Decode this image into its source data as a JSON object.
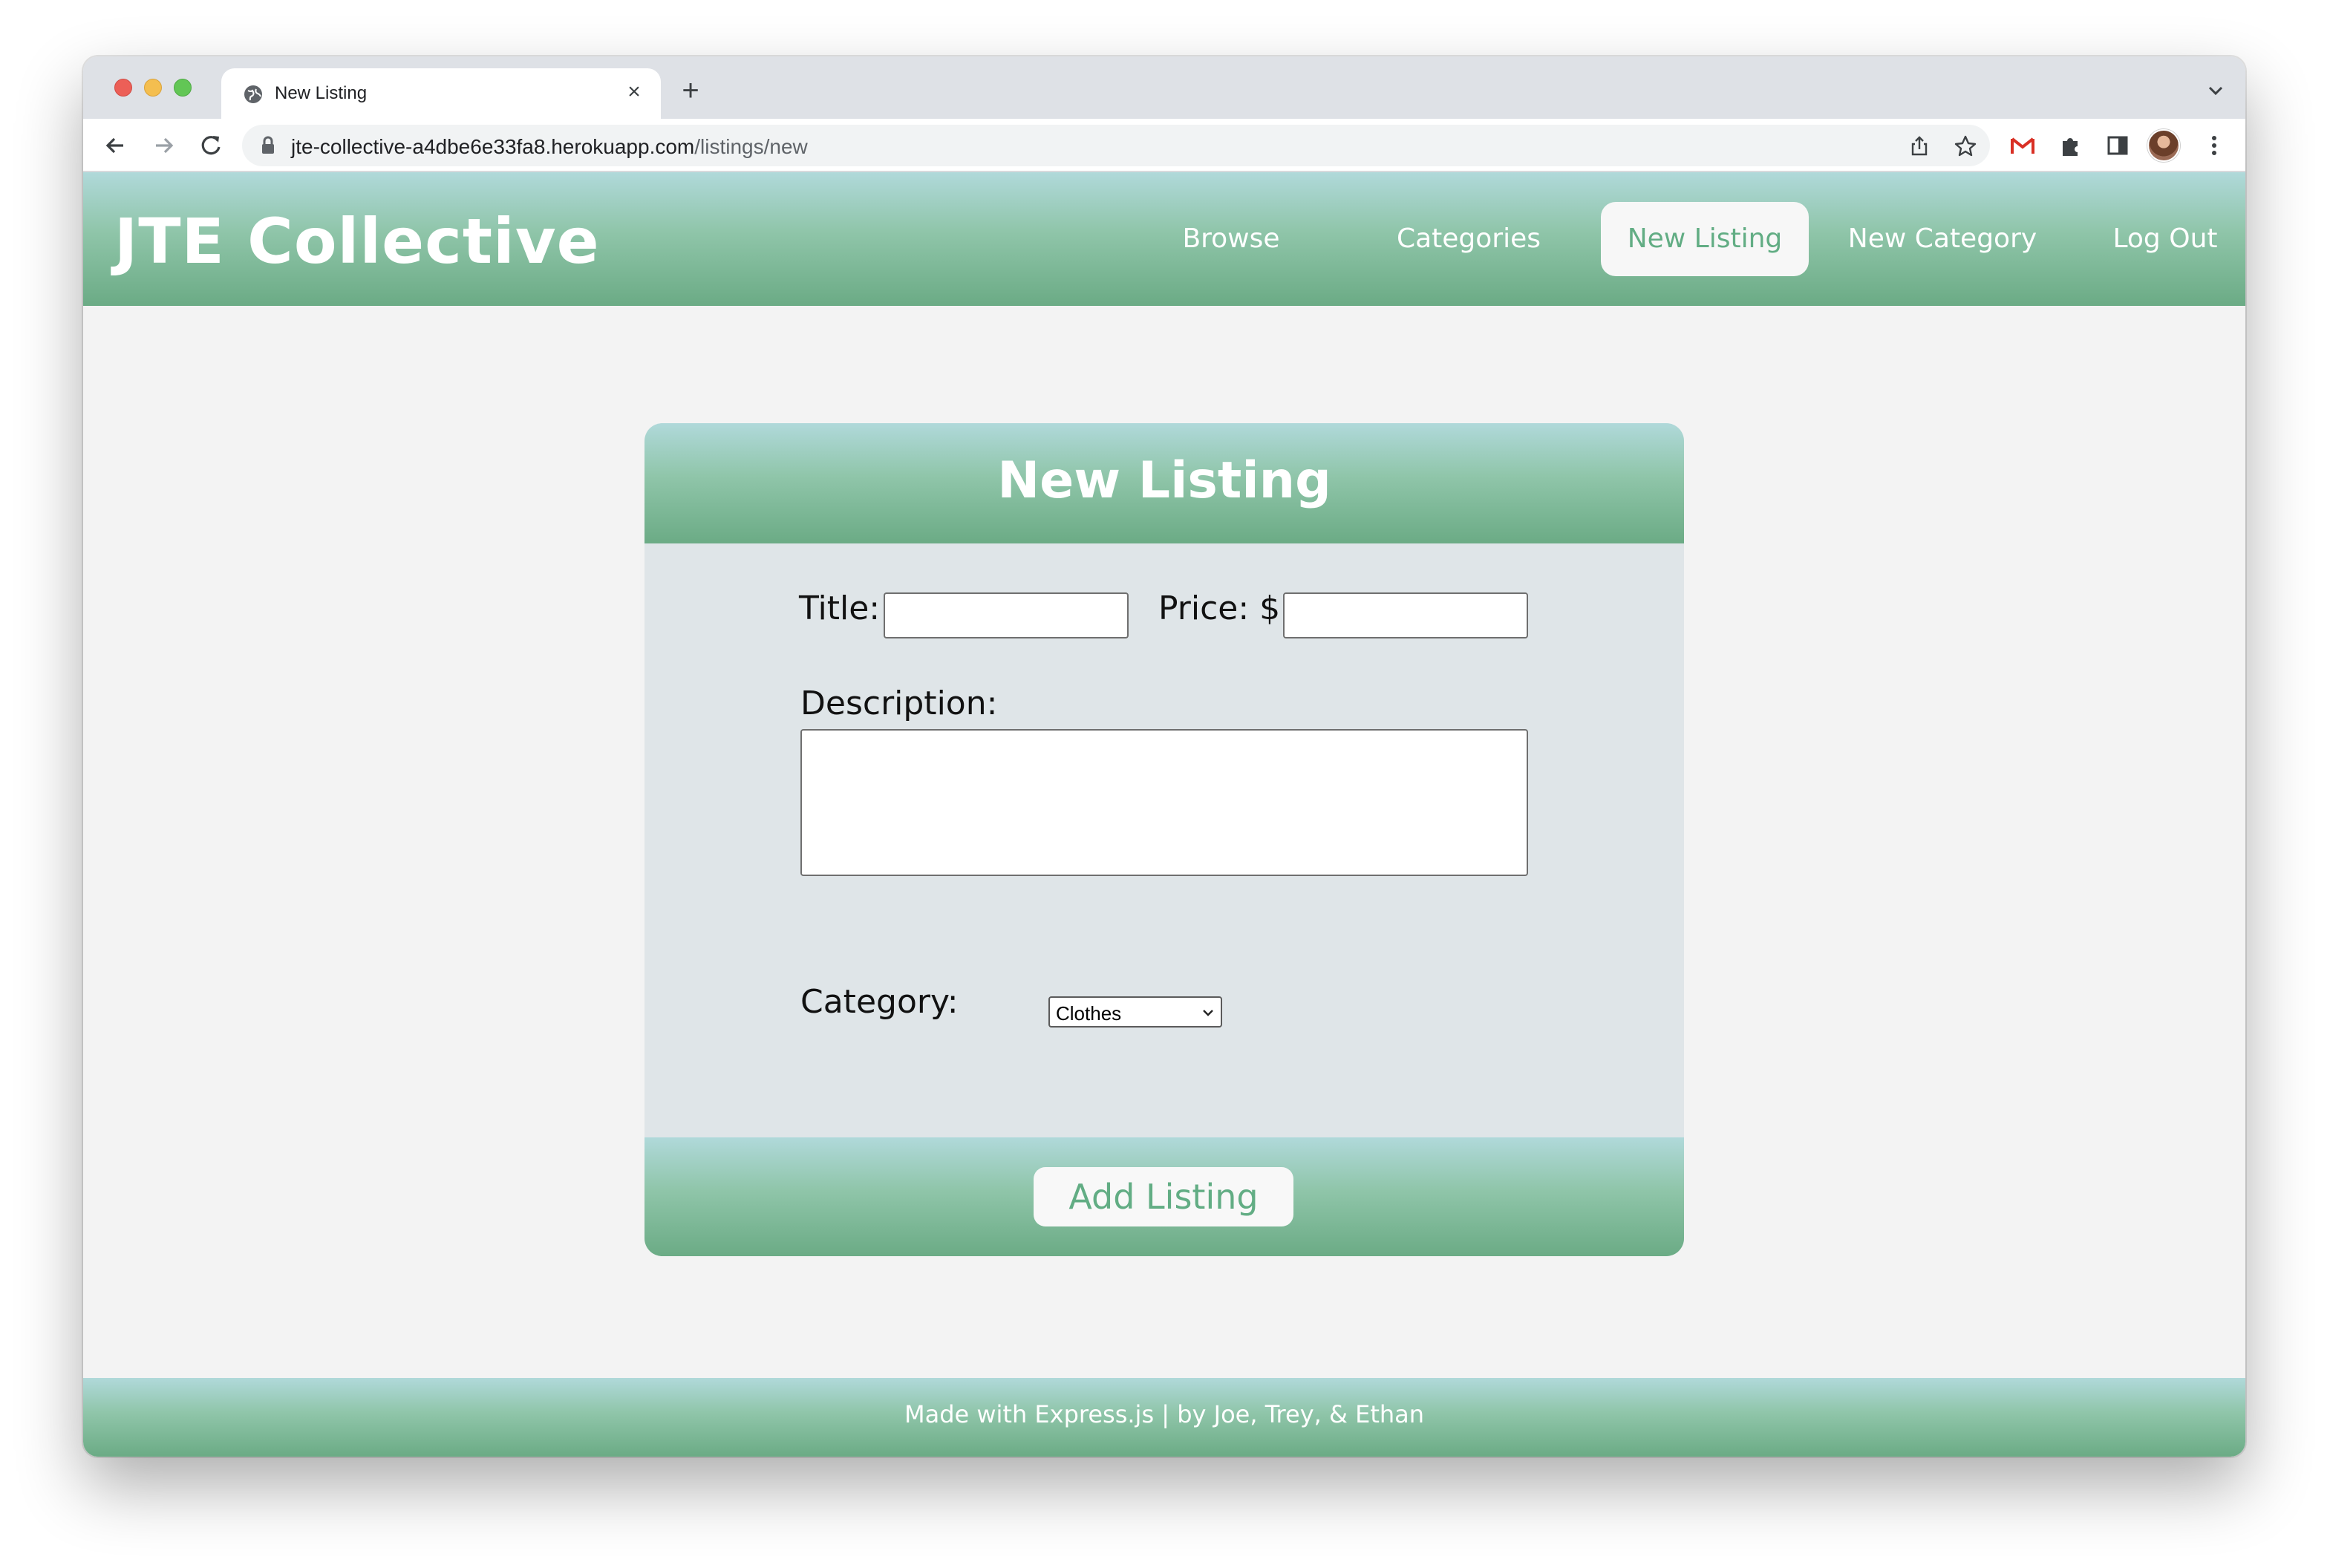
{
  "browser": {
    "tab_title": "New Listing",
    "tab_close": "×",
    "new_tab": "+",
    "url_host": "jte-collective-a4dbe6e33fa8.herokuapp.com",
    "url_path": "/listings/new",
    "icons": [
      "back-arrow-icon",
      "forward-arrow-icon",
      "reload-icon",
      "lock-icon",
      "share-icon",
      "star-icon",
      "gmail-icon",
      "extensions-icon",
      "side-panel-icon",
      "profile-avatar",
      "more-menu-icon",
      "tab-list-chevron-icon"
    ]
  },
  "header": {
    "brand": "JTE Collective",
    "nav": [
      {
        "label": "Browse",
        "active": false
      },
      {
        "label": "Categories",
        "active": false
      },
      {
        "label": "New Listing",
        "active": true
      },
      {
        "label": "New Category",
        "active": false
      },
      {
        "label": "Log Out",
        "active": false
      }
    ]
  },
  "form": {
    "heading": "New Listing",
    "title_label": "Title:",
    "title_value": "",
    "price_label": "Price: $",
    "price_value": "",
    "description_label": "Description:",
    "description_value": "",
    "category_label": "Category:",
    "category_selected": "Clothes",
    "submit_label": "Add Listing"
  },
  "footer": {
    "text": "Made with Express.js | by Joe, Trey, & Ethan"
  },
  "colors": {
    "accent_green": "#62ad84",
    "gradient_top": "#b0d9da",
    "gradient_bottom": "#6bab85",
    "page_bg": "#f3f3f3",
    "form_bg": "#dfe5e8"
  }
}
